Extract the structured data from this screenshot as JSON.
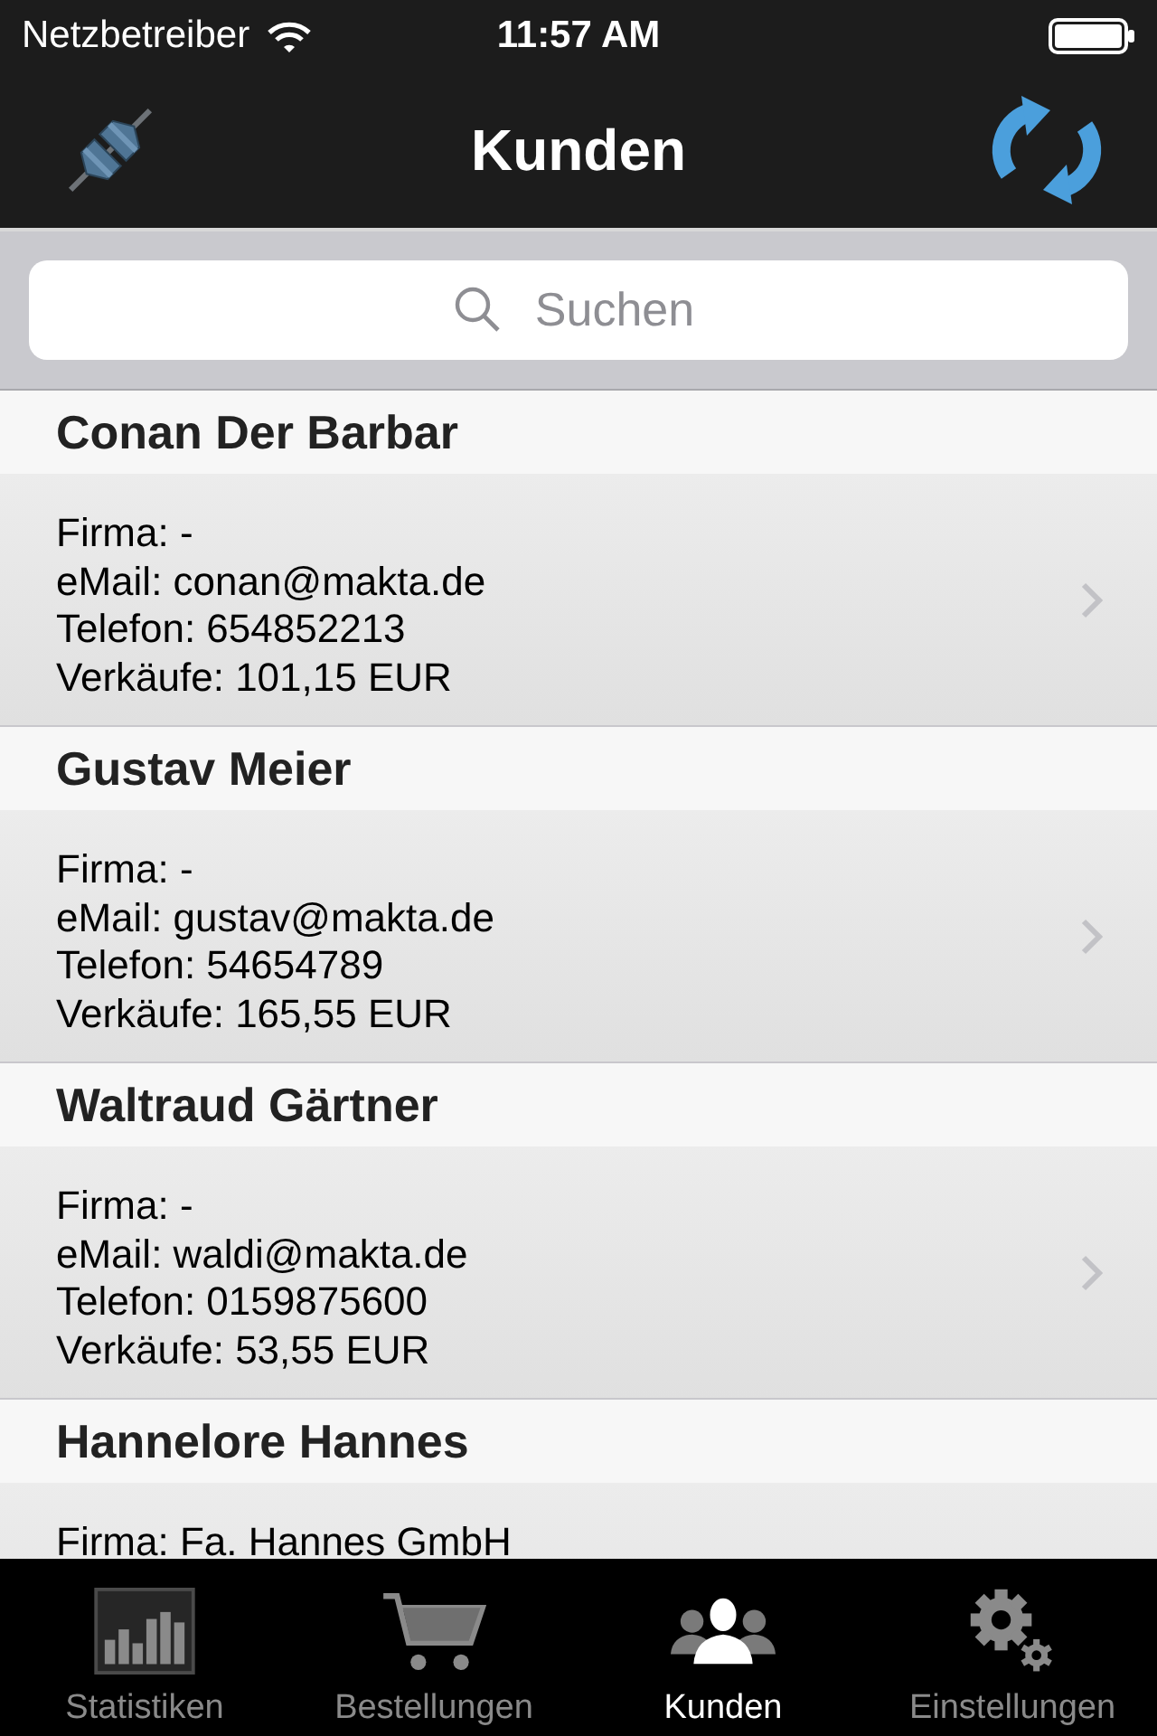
{
  "status_bar": {
    "carrier": "Netzbetreiber",
    "time": "11:57 AM"
  },
  "nav_bar": {
    "title": "Kunden"
  },
  "search": {
    "placeholder": "Suchen"
  },
  "customers": [
    {
      "name": "Conan Der Barbar",
      "details": [
        "Firma: -",
        "eMail: conan@makta.de",
        "Telefon: 654852213",
        "Verkäufe: 101,15 EUR"
      ],
      "chevron": true
    },
    {
      "name": "Gustav Meier",
      "details": [
        "Firma: -",
        "eMail: gustav@makta.de",
        "Telefon: 54654789",
        "Verkäufe: 165,55 EUR"
      ],
      "chevron": true
    },
    {
      "name": "Waltraud Gärtner",
      "details": [
        "Firma: -",
        "eMail: waldi@makta.de",
        "Telefon: 0159875600",
        "Verkäufe: 53,55 EUR"
      ],
      "chevron": true
    },
    {
      "name": "Hannelore Hannes",
      "details": [
        "Firma: Fa. Hannes GmbH"
      ],
      "chevron": false
    }
  ],
  "tab_bar": [
    {
      "label": "Statistiken",
      "kind": "chart",
      "selected": false
    },
    {
      "label": "Bestellungen",
      "kind": "cart",
      "selected": false
    },
    {
      "label": "Kunden",
      "kind": "people",
      "selected": true
    },
    {
      "label": "Einstellungen",
      "kind": "gears",
      "selected": false
    }
  ]
}
